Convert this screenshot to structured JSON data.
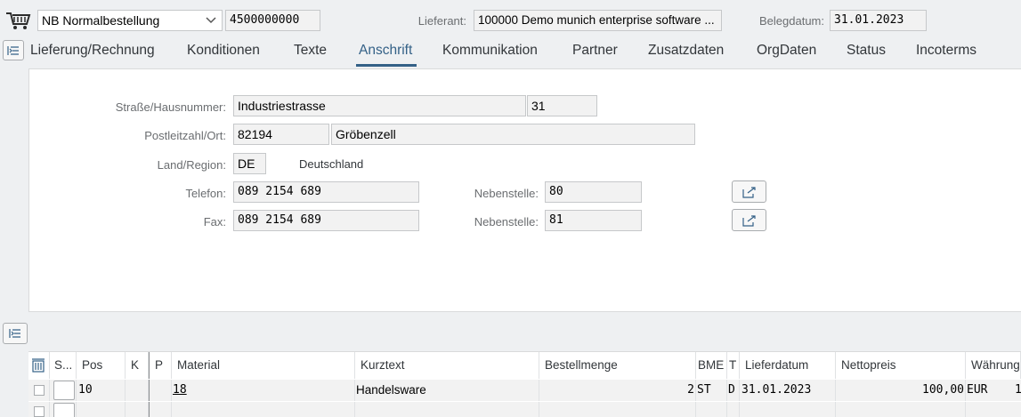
{
  "header": {
    "order_type": "NB Normalbestellung",
    "order_number": "4500000000",
    "vendor_label": "Lieferant:",
    "vendor_value": "100000 Demo munich enterprise software ...",
    "doc_date_label": "Belegdatum:",
    "doc_date_value": "31.01.2023"
  },
  "tabs": [
    {
      "label": "Lieferung/Rechnung"
    },
    {
      "label": "Konditionen"
    },
    {
      "label": "Texte"
    },
    {
      "label": "Anschrift"
    },
    {
      "label": "Kommunikation"
    },
    {
      "label": "Partner"
    },
    {
      "label": "Zusatzdaten"
    },
    {
      "label": "OrgDaten"
    },
    {
      "label": "Status"
    },
    {
      "label": "Incoterms"
    }
  ],
  "active_tab": "Anschrift",
  "address": {
    "street_label": "Straße/Hausnummer:",
    "street_value": "Industriestrasse",
    "house_number": "31",
    "postal_label": "Postleitzahl/Ort:",
    "postal_code": "82194",
    "city": "Gröbenzell",
    "country_label": "Land/Region:",
    "country_code": "DE",
    "country_name": "Deutschland",
    "phone_label": "Telefon:",
    "phone_value": "089 2154 689",
    "phone_ext_label": "Nebenstelle:",
    "phone_ext_value": "80",
    "fax_label": "Fax:",
    "fax_value": "089 2154 689",
    "fax_ext_label": "Nebenstelle:",
    "fax_ext_value": "81"
  },
  "items_table": {
    "columns": [
      "S...",
      "Pos",
      "K",
      "P",
      "Material",
      "Kurztext",
      "Bestellmenge",
      "BME",
      "T",
      "Lieferdatum",
      "Nettopreis",
      "Währung"
    ],
    "rows": [
      {
        "pos": "10",
        "material": "18",
        "short_text": "Handelsware",
        "quantity": "2",
        "uom": "ST",
        "type": "D",
        "delivery_date": "31.01.2023",
        "net_price": "100,00",
        "currency": "EUR",
        "extra": "1"
      }
    ]
  },
  "colors": {
    "accent": "#346187",
    "background": "#eef0f2",
    "field": "#f2f2f2"
  }
}
